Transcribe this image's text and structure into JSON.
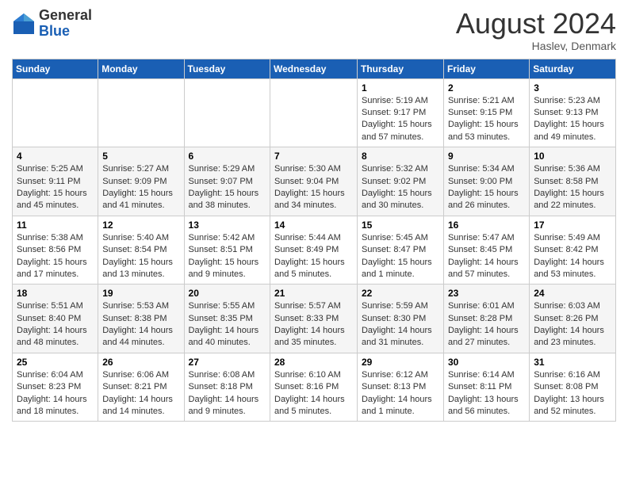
{
  "header": {
    "logo": {
      "general": "General",
      "blue": "Blue"
    },
    "month": "August 2024",
    "location": "Haslev, Denmark"
  },
  "weekdays": [
    "Sunday",
    "Monday",
    "Tuesday",
    "Wednesday",
    "Thursday",
    "Friday",
    "Saturday"
  ],
  "weeks": [
    [
      {
        "day": "",
        "info": ""
      },
      {
        "day": "",
        "info": ""
      },
      {
        "day": "",
        "info": ""
      },
      {
        "day": "",
        "info": ""
      },
      {
        "day": "1",
        "info": "Sunrise: 5:19 AM\nSunset: 9:17 PM\nDaylight: 15 hours\nand 57 minutes."
      },
      {
        "day": "2",
        "info": "Sunrise: 5:21 AM\nSunset: 9:15 PM\nDaylight: 15 hours\nand 53 minutes."
      },
      {
        "day": "3",
        "info": "Sunrise: 5:23 AM\nSunset: 9:13 PM\nDaylight: 15 hours\nand 49 minutes."
      }
    ],
    [
      {
        "day": "4",
        "info": "Sunrise: 5:25 AM\nSunset: 9:11 PM\nDaylight: 15 hours\nand 45 minutes."
      },
      {
        "day": "5",
        "info": "Sunrise: 5:27 AM\nSunset: 9:09 PM\nDaylight: 15 hours\nand 41 minutes."
      },
      {
        "day": "6",
        "info": "Sunrise: 5:29 AM\nSunset: 9:07 PM\nDaylight: 15 hours\nand 38 minutes."
      },
      {
        "day": "7",
        "info": "Sunrise: 5:30 AM\nSunset: 9:04 PM\nDaylight: 15 hours\nand 34 minutes."
      },
      {
        "day": "8",
        "info": "Sunrise: 5:32 AM\nSunset: 9:02 PM\nDaylight: 15 hours\nand 30 minutes."
      },
      {
        "day": "9",
        "info": "Sunrise: 5:34 AM\nSunset: 9:00 PM\nDaylight: 15 hours\nand 26 minutes."
      },
      {
        "day": "10",
        "info": "Sunrise: 5:36 AM\nSunset: 8:58 PM\nDaylight: 15 hours\nand 22 minutes."
      }
    ],
    [
      {
        "day": "11",
        "info": "Sunrise: 5:38 AM\nSunset: 8:56 PM\nDaylight: 15 hours\nand 17 minutes."
      },
      {
        "day": "12",
        "info": "Sunrise: 5:40 AM\nSunset: 8:54 PM\nDaylight: 15 hours\nand 13 minutes."
      },
      {
        "day": "13",
        "info": "Sunrise: 5:42 AM\nSunset: 8:51 PM\nDaylight: 15 hours\nand 9 minutes."
      },
      {
        "day": "14",
        "info": "Sunrise: 5:44 AM\nSunset: 8:49 PM\nDaylight: 15 hours\nand 5 minutes."
      },
      {
        "day": "15",
        "info": "Sunrise: 5:45 AM\nSunset: 8:47 PM\nDaylight: 15 hours\nand 1 minute."
      },
      {
        "day": "16",
        "info": "Sunrise: 5:47 AM\nSunset: 8:45 PM\nDaylight: 14 hours\nand 57 minutes."
      },
      {
        "day": "17",
        "info": "Sunrise: 5:49 AM\nSunset: 8:42 PM\nDaylight: 14 hours\nand 53 minutes."
      }
    ],
    [
      {
        "day": "18",
        "info": "Sunrise: 5:51 AM\nSunset: 8:40 PM\nDaylight: 14 hours\nand 48 minutes."
      },
      {
        "day": "19",
        "info": "Sunrise: 5:53 AM\nSunset: 8:38 PM\nDaylight: 14 hours\nand 44 minutes."
      },
      {
        "day": "20",
        "info": "Sunrise: 5:55 AM\nSunset: 8:35 PM\nDaylight: 14 hours\nand 40 minutes."
      },
      {
        "day": "21",
        "info": "Sunrise: 5:57 AM\nSunset: 8:33 PM\nDaylight: 14 hours\nand 35 minutes."
      },
      {
        "day": "22",
        "info": "Sunrise: 5:59 AM\nSunset: 8:30 PM\nDaylight: 14 hours\nand 31 minutes."
      },
      {
        "day": "23",
        "info": "Sunrise: 6:01 AM\nSunset: 8:28 PM\nDaylight: 14 hours\nand 27 minutes."
      },
      {
        "day": "24",
        "info": "Sunrise: 6:03 AM\nSunset: 8:26 PM\nDaylight: 14 hours\nand 23 minutes."
      }
    ],
    [
      {
        "day": "25",
        "info": "Sunrise: 6:04 AM\nSunset: 8:23 PM\nDaylight: 14 hours\nand 18 minutes."
      },
      {
        "day": "26",
        "info": "Sunrise: 6:06 AM\nSunset: 8:21 PM\nDaylight: 14 hours\nand 14 minutes."
      },
      {
        "day": "27",
        "info": "Sunrise: 6:08 AM\nSunset: 8:18 PM\nDaylight: 14 hours\nand 9 minutes."
      },
      {
        "day": "28",
        "info": "Sunrise: 6:10 AM\nSunset: 8:16 PM\nDaylight: 14 hours\nand 5 minutes."
      },
      {
        "day": "29",
        "info": "Sunrise: 6:12 AM\nSunset: 8:13 PM\nDaylight: 14 hours\nand 1 minute."
      },
      {
        "day": "30",
        "info": "Sunrise: 6:14 AM\nSunset: 8:11 PM\nDaylight: 13 hours\nand 56 minutes."
      },
      {
        "day": "31",
        "info": "Sunrise: 6:16 AM\nSunset: 8:08 PM\nDaylight: 13 hours\nand 52 minutes."
      }
    ]
  ]
}
